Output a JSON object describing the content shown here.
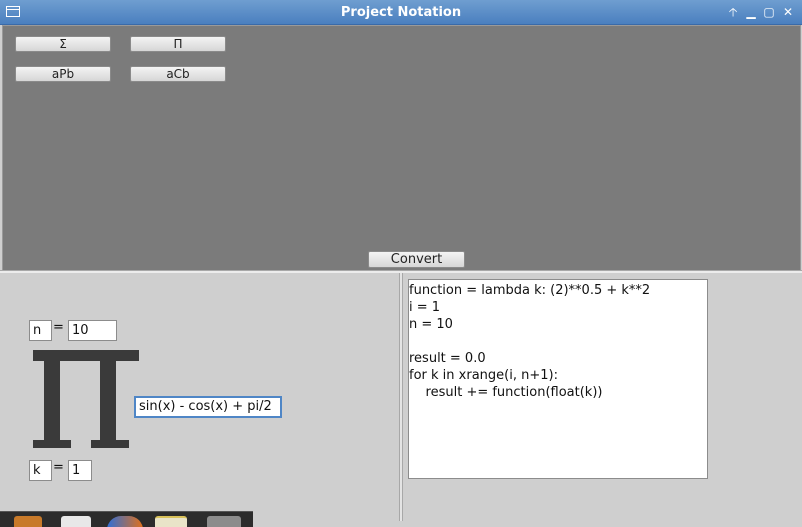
{
  "window": {
    "title": "Project Notation"
  },
  "toolbar": {
    "buttons": [
      {
        "label": "Σ"
      },
      {
        "label": "Π"
      },
      {
        "label": "aPb"
      },
      {
        "label": "aCb"
      }
    ],
    "convert_label": "Convert"
  },
  "notation": {
    "upper_var": "n",
    "upper_value": "10",
    "lower_var": "k",
    "lower_value": "1",
    "equals": "=",
    "symbol": "product-symbol",
    "expression": "sin(x) - cos(x) + pi/2"
  },
  "code": {
    "lines": [
      "function = lambda k: (2)**0.5 + k**2",
      "i = 1",
      "n = 10",
      "",
      "result = 0.0",
      "for k in xrange(i, n+1):",
      "    result += function(float(k))"
    ]
  },
  "titlebar_controls": [
    "up-arrow-icon",
    "minimize-icon",
    "maximize-icon",
    "close-icon"
  ],
  "taskbar": {
    "icons": [
      "archive-icon",
      "document-icon",
      "browser-icon",
      "calendar-icon",
      "folder-icon"
    ]
  },
  "colors": {
    "titlebar": "#5b8dc8",
    "top_panel": "#7b7b7b",
    "focus_border": "#4f86c6"
  }
}
